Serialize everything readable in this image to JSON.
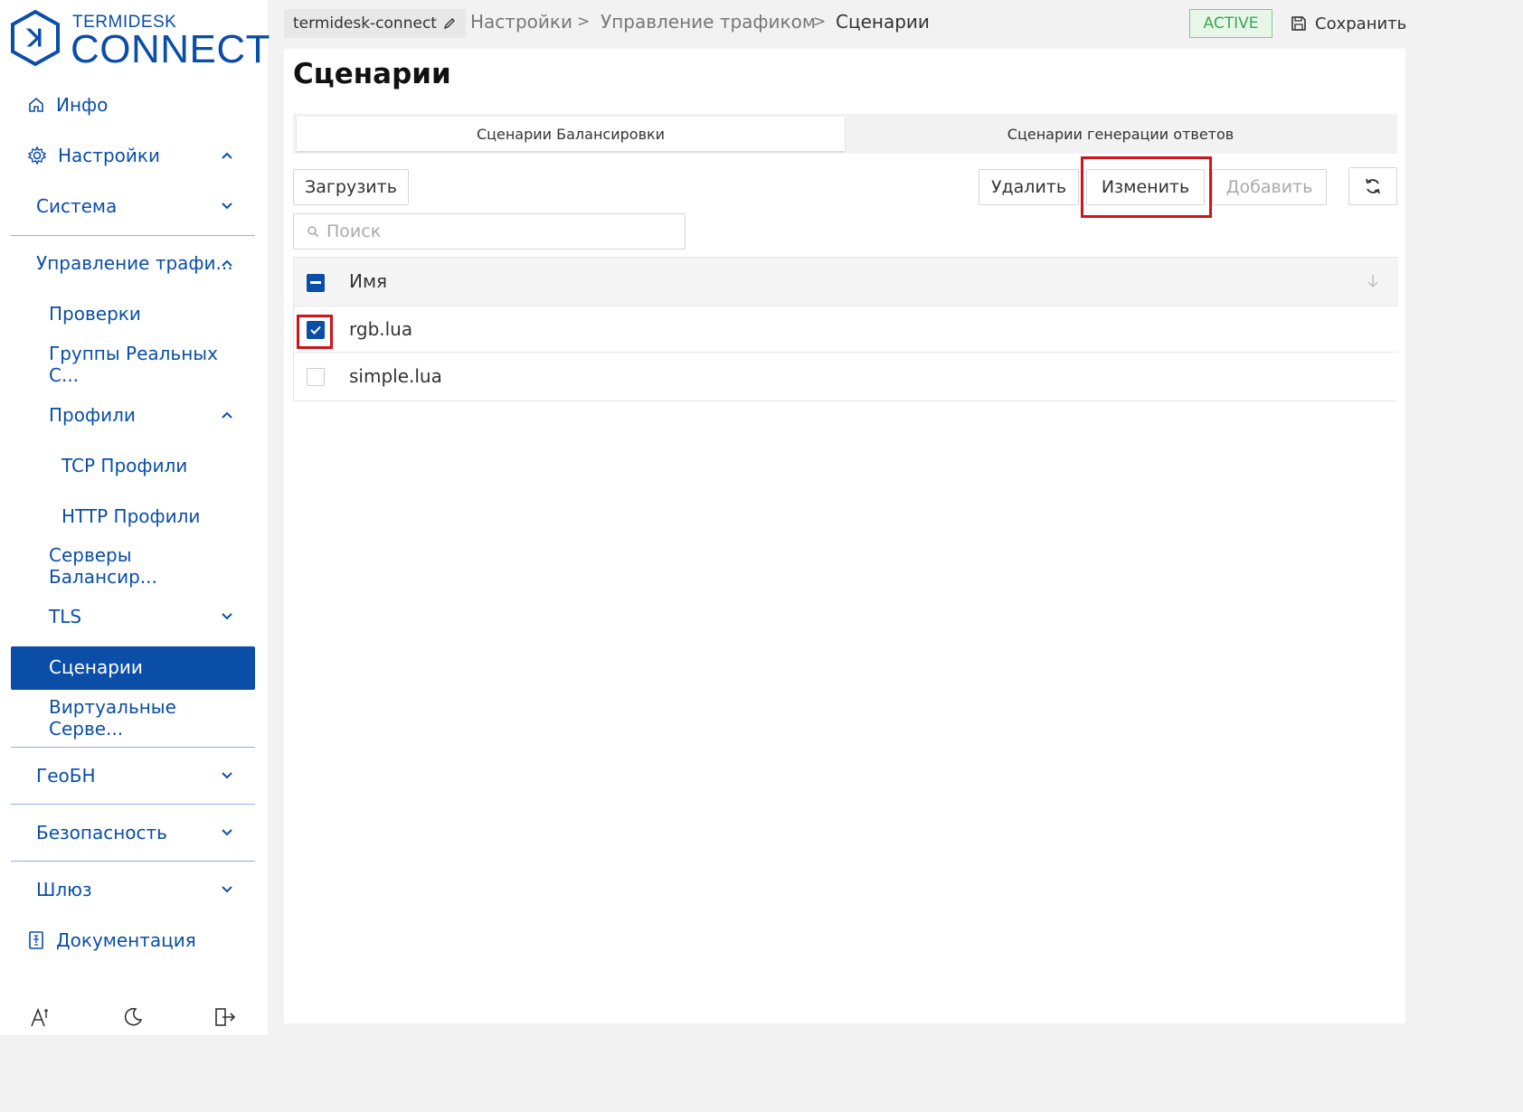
{
  "logo": {
    "top_text": "TERMIDESK",
    "main_text": "CONNECT"
  },
  "sidebar": {
    "info": "Инфо",
    "settings": "Настройки",
    "system": "Система",
    "traffic": "Управление трафи...",
    "checks": "Проверки",
    "real_groups": "Группы Реальных С...",
    "profiles": "Профили",
    "tcp_profiles": "TCP Профили",
    "http_profiles": "HTTP Профили",
    "balancer_servers": "Серверы Балансир...",
    "tls": "TLS",
    "scenarios": "Сценарии",
    "virtual_servers": "Виртуальные Серве...",
    "geobn": "ГеоБН",
    "security": "Безопасность",
    "gateway": "Шлюз",
    "docs": "Документация"
  },
  "topbar": {
    "connection": "termidesk-connect",
    "crumb1": "Настройки",
    "crumb2": "Управление трафиком",
    "crumb3": "Сценарии",
    "separator": ">",
    "status": "ACTIVE",
    "save": "Сохранить"
  },
  "page": {
    "title": "Сценарии",
    "tab_balancing": "Сценарии Балансировки",
    "tab_responses": "Сценарии генерации ответов",
    "upload": "Загрузить",
    "delete": "Удалить",
    "edit": "Изменить",
    "add": "Добавить",
    "search_placeholder": "Поиск"
  },
  "table": {
    "column_name": "Имя",
    "rows": [
      {
        "name": "rgb.lua",
        "checked": true
      },
      {
        "name": "simple.lua",
        "checked": false
      }
    ]
  },
  "colors": {
    "accent": "#0a4ea8",
    "highlight": "#d0141b",
    "status_green": "#3aa653"
  }
}
